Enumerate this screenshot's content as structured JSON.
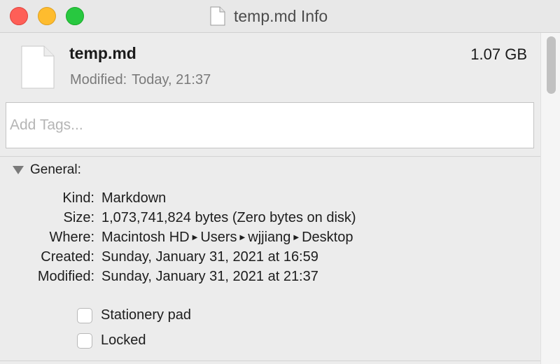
{
  "window": {
    "title": "temp.md Info"
  },
  "file": {
    "name": "temp.md",
    "size": "1.07 GB",
    "modified_label": "Modified:",
    "modified_value": "Today, 21:37",
    "icon": "document-icon"
  },
  "tags": {
    "placeholder": "Add Tags..."
  },
  "general": {
    "title": "General:",
    "rows": [
      {
        "label": "Kind:",
        "value": "Markdown"
      },
      {
        "label": "Size:",
        "value": "1,073,741,824 bytes (Zero bytes on disk)"
      },
      {
        "label": "Where:",
        "path": [
          "Macintosh HD",
          "Users",
          "wjjiang",
          "Desktop"
        ]
      },
      {
        "label": "Created:",
        "value": "Sunday, January 31, 2021 at 16:59"
      },
      {
        "label": "Modified:",
        "value": "Sunday, January 31, 2021 at 21:37"
      }
    ],
    "checkboxes": [
      {
        "label": "Stationery pad",
        "checked": false
      },
      {
        "label": "Locked",
        "checked": false
      }
    ]
  },
  "colors": {
    "close": "#fe5f57",
    "minimize": "#febc2e",
    "zoom": "#28c840"
  }
}
